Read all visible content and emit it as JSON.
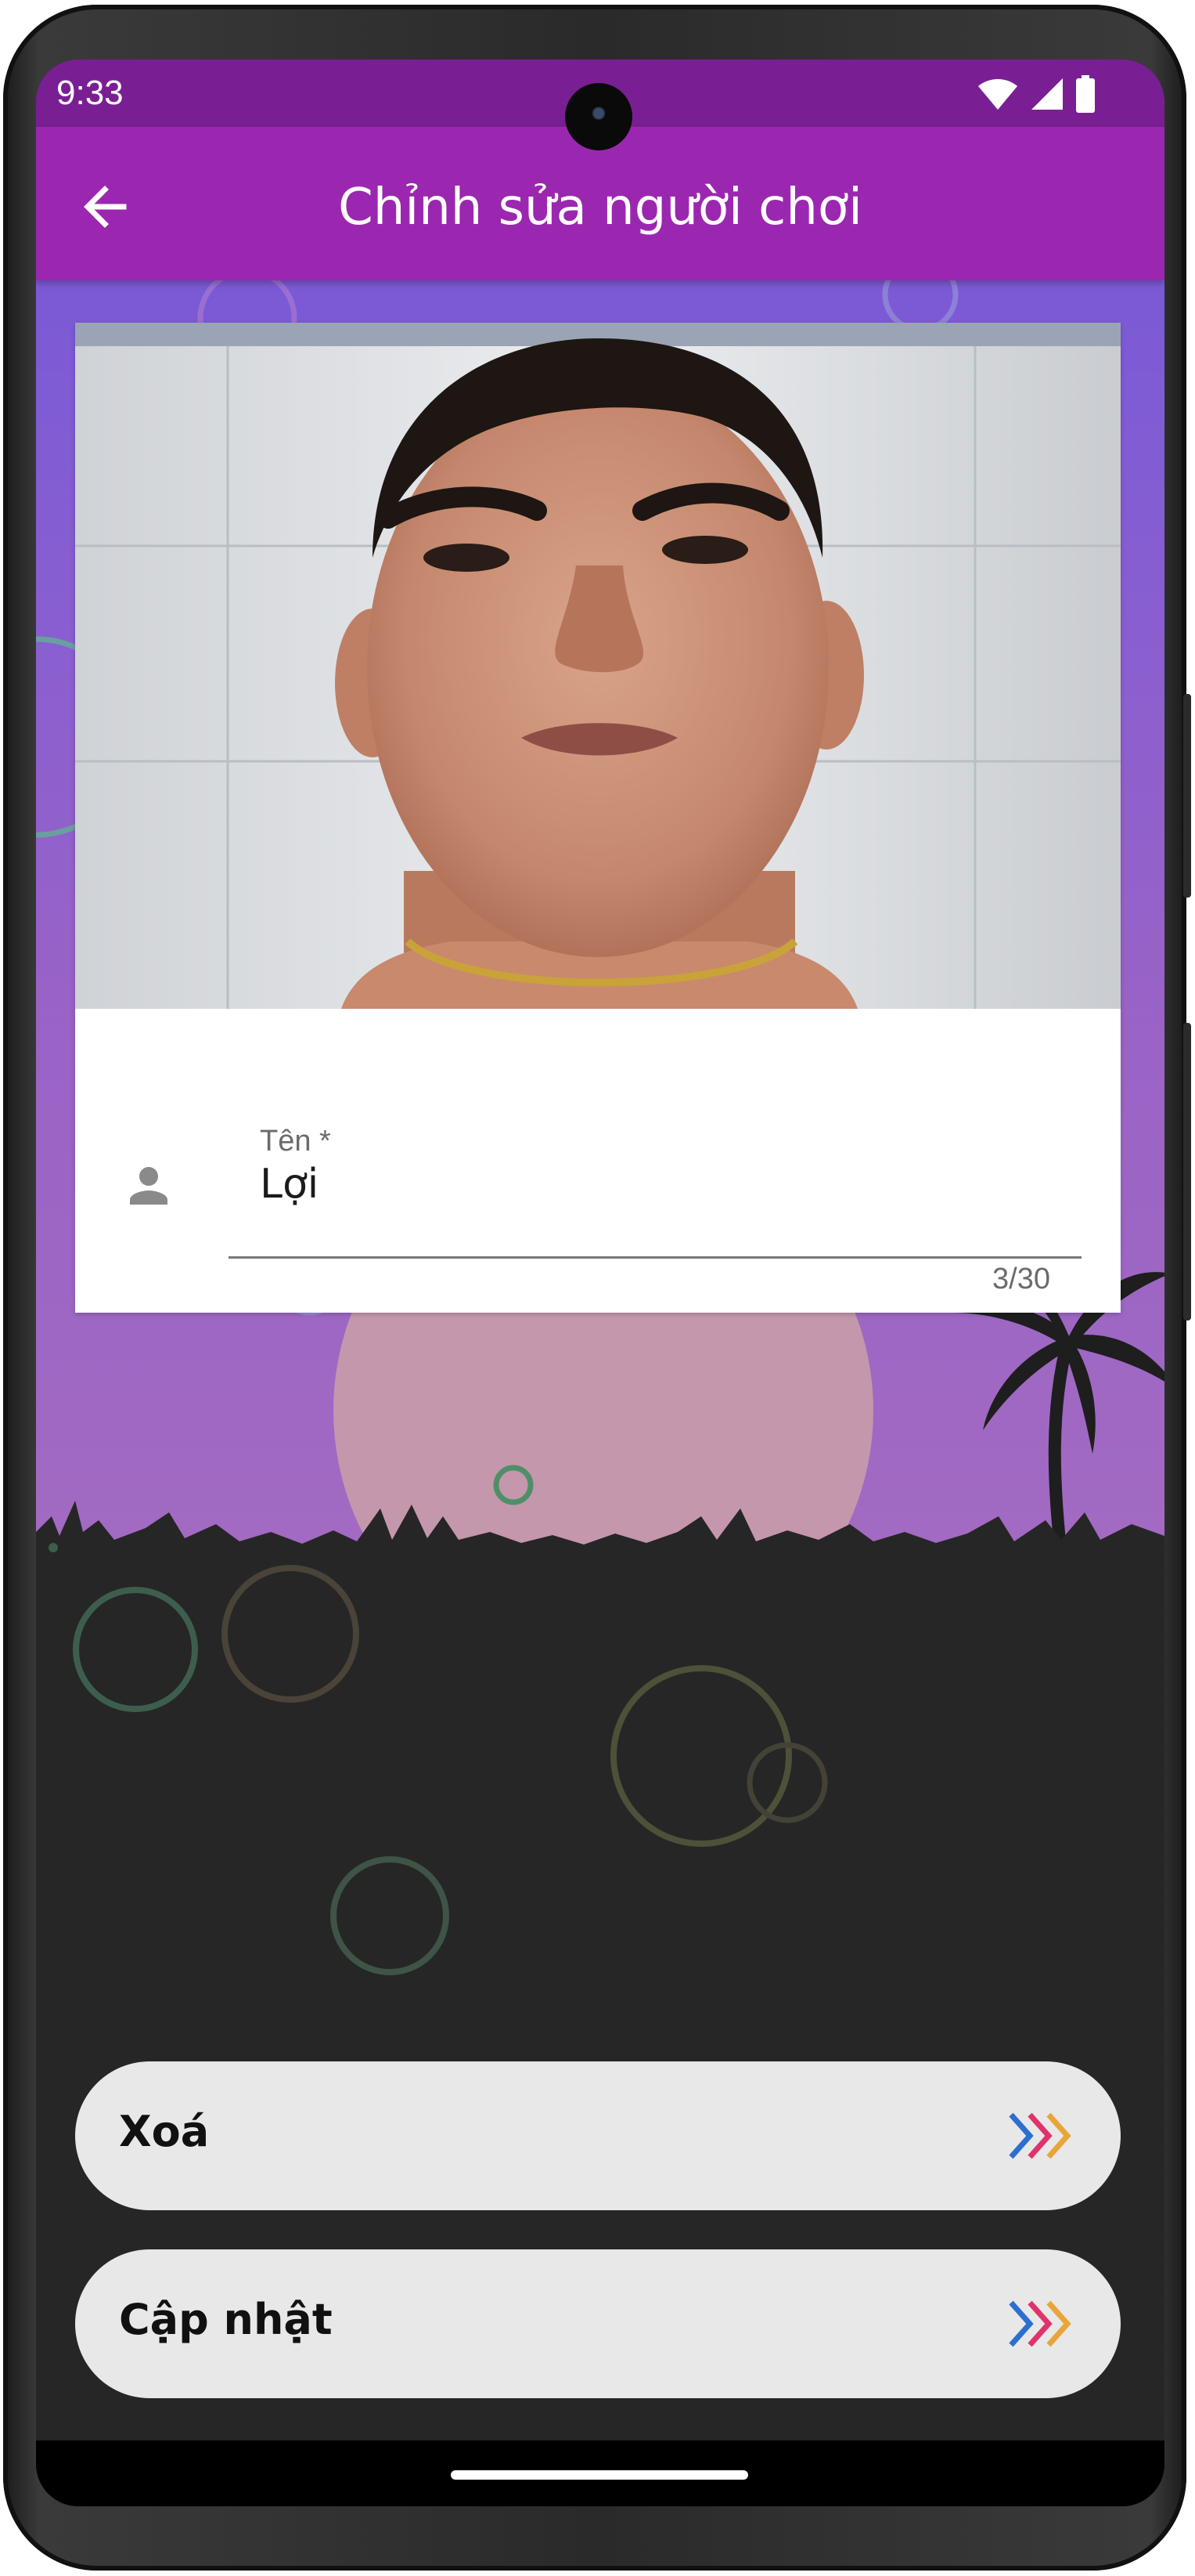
{
  "status_bar": {
    "time": "9:33",
    "icons": [
      "wifi-icon",
      "cellular-signal-icon",
      "battery-icon"
    ]
  },
  "app_bar": {
    "title": "Chỉnh sửa người chơi",
    "back_icon": "arrow-left-icon",
    "color": "#9b27b0"
  },
  "player_card": {
    "photo": "player-face-photo",
    "name_field": {
      "label": "Tên *",
      "value": "Lợi",
      "counter": "3/30",
      "icon": "person-icon"
    }
  },
  "actions": [
    {
      "label": "Xoá",
      "icon": "triple-chevron-right-icon"
    },
    {
      "label": "Cập nhật",
      "icon": "triple-chevron-right-icon"
    }
  ],
  "colors": {
    "status_bar": "#7a1f93",
    "sky_top": "#7b5ad6",
    "sky_bottom": "#a26ac2",
    "ground": "#262626",
    "button_bg": "#e8e8e8"
  }
}
